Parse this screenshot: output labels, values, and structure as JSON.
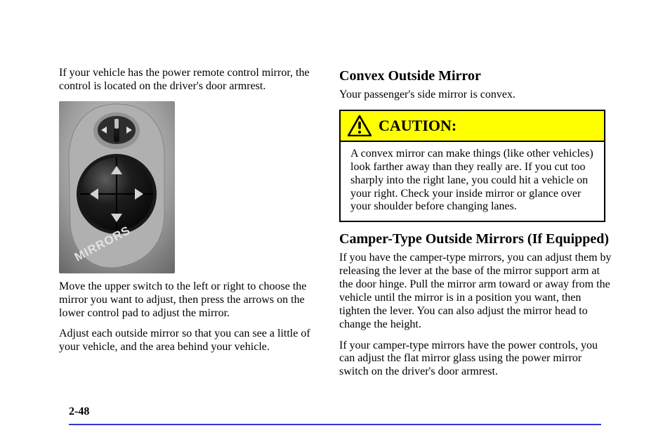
{
  "leftColumn": {
    "intro": "If your vehicle has the power remote control mirror, the control is located on the driver's door armrest.",
    "step1": "Move the upper switch to the left or right to choose the mirror you want to adjust, then press the arrows on the lower control pad to adjust the mirror.",
    "step2": "Adjust each outside mirror so that you can see a little of your vehicle, and the area behind your vehicle."
  },
  "rightColumn": {
    "heading": "Convex Outside Mirror",
    "intro": "Your passenger's side mirror is convex.",
    "caution": {
      "label": "CAUTION:",
      "text": "A convex mirror can make things (like other vehicles) look farther away than they really are. If you cut too sharply into the right lane, you could hit a vehicle on your right. Check your inside mirror or glance over your shoulder before changing lanes."
    },
    "heading2": "Camper-Type Outside Mirrors (If Equipped)",
    "p2": "If you have the camper-type mirrors, you can adjust them by releasing the lever at the base of the mirror support arm at the door hinge. Pull the mirror arm toward or away from the vehicle until the mirror is in a position you want, then tighten the lever. You can also adjust the mirror head to change the height.",
    "p3": "If your camper-type mirrors have the power controls, you can adjust the flat mirror glass using the power mirror switch on the driver's door armrest."
  },
  "pageNumber": "2-48"
}
